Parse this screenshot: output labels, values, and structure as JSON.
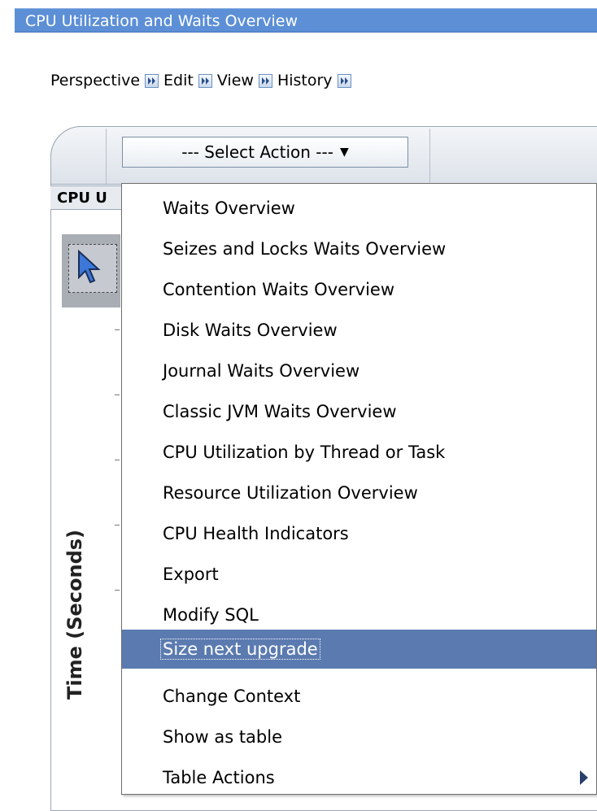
{
  "window": {
    "title": "CPU Utilization and Waits Overview"
  },
  "nav": {
    "items": [
      {
        "label": "Perspective"
      },
      {
        "label": "Edit"
      },
      {
        "label": "View"
      },
      {
        "label": "History"
      }
    ]
  },
  "toolbar": {
    "select_label": "--- Select Action ---"
  },
  "chart_header": {
    "title_visible": "CPU U"
  },
  "chart": {
    "y_axis_label": "Time (Seconds)"
  },
  "menu": {
    "items": [
      {
        "label": "Waits Overview"
      },
      {
        "label": "Seizes and Locks Waits Overview"
      },
      {
        "label": "Contention Waits Overview"
      },
      {
        "label": "Disk Waits Overview"
      },
      {
        "label": "Journal Waits Overview"
      },
      {
        "label": "Classic JVM Waits Overview"
      },
      {
        "label": "CPU Utilization by Thread or Task"
      },
      {
        "label": "Resource Utilization Overview"
      },
      {
        "label": "CPU Health Indicators"
      },
      {
        "label": "Export"
      },
      {
        "label": "Modify SQL"
      },
      {
        "label": "Size next upgrade",
        "selected": true
      },
      {
        "label": "Change Context"
      },
      {
        "label": "Show as table"
      },
      {
        "label": "Table Actions",
        "has_submenu": true
      }
    ]
  },
  "colors": {
    "title_bar": "#5c8fd6",
    "selection": "#5b7bb0"
  }
}
